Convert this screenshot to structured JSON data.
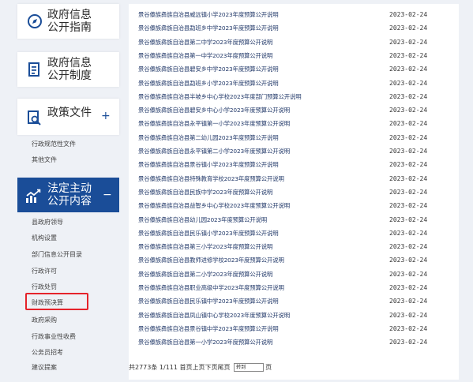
{
  "sidebar": {
    "guide_title_l1": "政府信息",
    "guide_title_l2": "公开指南",
    "system_title_l1": "政府信息",
    "system_title_l2": "公开制度",
    "policy_title": "政策文件",
    "policy_toggle": "+",
    "policy_items": [
      "行政规范性文件",
      "其他文件"
    ],
    "active_title_l1": "法定主动",
    "active_title_l2": "公开内容",
    "active_toggle": "−",
    "active_items": [
      "县政府领导",
      "机构设置",
      "部门信息公开目录",
      "行政许可",
      "行政处罚",
      "财政预决算",
      "政府采购",
      "行政事业性收费",
      "公务员招考",
      "建议提案"
    ]
  },
  "list": {
    "rows": [
      {
        "title": "景谷傣族彝族自治县威远镇小学2023年度预算公开说明",
        "date": "2023-02-24"
      },
      {
        "title": "景谷傣族彝族自治县勐班乡中学2023年度预算公开说明",
        "date": "2023-02-24"
      },
      {
        "title": "景谷傣族彝族自治县第二中学2023年度预算公开说明",
        "date": "2023-02-24"
      },
      {
        "title": "景谷傣族彝族自治县第一中学2023年度预算公开说明",
        "date": "2023-02-24"
      },
      {
        "title": "景谷傣族彝族自治县碧安乡中学2023年度预算公开说明",
        "date": "2023-02-24"
      },
      {
        "title": "景谷傣族彝族自治县勐班乡小学2023年度预算公开说明",
        "date": "2023-02-24"
      },
      {
        "title": "景谷傣族彝族自治县半坡乡中心学校2023年度部门预算公开说明",
        "date": "2023-02-24"
      },
      {
        "title": "景谷傣族彝族自治县碧安乡中心小学2023年度预算公开说明",
        "date": "2023-02-24"
      },
      {
        "title": "景谷傣族彝族自治县永平镇第一小学2023年度预算公开说明",
        "date": "2023-02-24"
      },
      {
        "title": "景谷傣族彝族自治县第二幼儿园2023年度预算公开说明",
        "date": "2023-02-24"
      },
      {
        "title": "景谷傣族彝族自治县永平镇第二小学2023年度预算公开说明",
        "date": "2023-02-24"
      },
      {
        "title": "景谷傣族彝族自治县景谷镇小学2023年度预算公开说明",
        "date": "2023-02-24"
      },
      {
        "title": "景谷傣族彝族自治县特殊教育学校2023年度预算公开说明",
        "date": "2023-02-24"
      },
      {
        "title": "景谷傣族彝族自治县民族中学2023年度预算公开说明",
        "date": "2023-02-24"
      },
      {
        "title": "景谷傣族彝族自治县益智乡中心学校2023年度预算公开说明",
        "date": "2023-02-24"
      },
      {
        "title": "景谷傣族彝族自治县幼儿园2023年度预算公开说明",
        "date": "2023-02-24"
      },
      {
        "title": "景谷傣族彝族自治县民乐镇小学2023年度预算公开说明",
        "date": "2023-02-24"
      },
      {
        "title": "景谷傣族彝族自治县第三小学2023年度预算公开说明",
        "date": "2023-02-24"
      },
      {
        "title": "景谷傣族彝族自治县教师进修学校2023年度预算公开说明",
        "date": "2023-02-24"
      },
      {
        "title": "景谷傣族彝族自治县第二小学2023年度预算公开说明",
        "date": "2023-02-24"
      },
      {
        "title": "景谷傣族彝族自治县职业高级中学2023年度预算公开说明",
        "date": "2023-02-24"
      },
      {
        "title": "景谷傣族彝族自治县民乐镇中学2023年度预算公开说明",
        "date": "2023-02-24"
      },
      {
        "title": "景谷傣族彝族自治县凤山镇中心学校2023年度预算公开说明",
        "date": "2023-02-24"
      },
      {
        "title": "景谷傣族彝族自治县景谷镇中学2023年度预算公开说明",
        "date": "2023-02-24"
      },
      {
        "title": "景谷傣族彝族自治县第一小学2023年度预算公开说明",
        "date": "2023-02-24"
      }
    ]
  },
  "pager": {
    "total": "共2773条",
    "page": "1/111",
    "links": "首页上页下页尾页",
    "goto_label": "转到",
    "page_unit": "页"
  },
  "colors": {
    "active_bg": "#1a4d98",
    "highlight": "#e5232b",
    "link": "#233a6a"
  }
}
